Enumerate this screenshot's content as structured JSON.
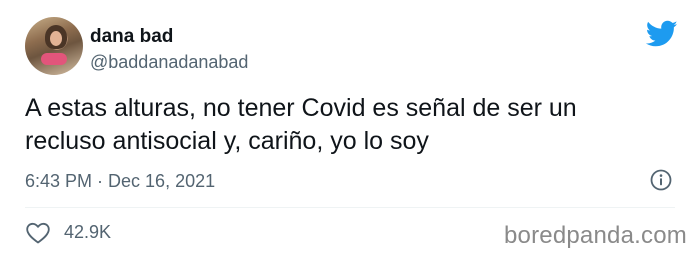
{
  "author": {
    "display_name": "dana bad",
    "handle": "@baddanadanabad"
  },
  "tweet": {
    "text_lines": [
      "A estas alturas, no tener Covid es señal de ser un",
      "recluso antisocial y, cariño, yo lo soy"
    ],
    "timestamp": "6:43 PM · Dec 16, 2021",
    "like_count": "42.9K"
  },
  "watermark": "boredpanda.com",
  "icons": {
    "brand": "twitter-bird-icon",
    "info": "info-icon",
    "like": "heart-icon"
  },
  "colors": {
    "twitter_blue": "#1d9bf0",
    "text_primary": "#0f1419",
    "text_secondary": "#536471",
    "divider": "#eff3f4"
  }
}
